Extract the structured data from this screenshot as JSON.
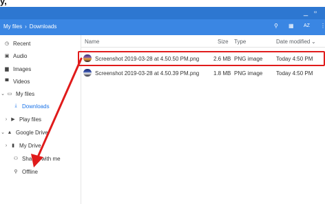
{
  "top_fragment": "y, ",
  "window": {
    "minimize": "_",
    "maximize": "▫"
  },
  "toolbar": {
    "breadcrumb": [
      "My files",
      "›",
      "Downloads"
    ],
    "icons": [
      "search-icon",
      "grid-view-icon",
      "sort-icon",
      "more-icon"
    ],
    "search_glyph": "⚲",
    "grid_glyph": "▦",
    "sort_glyph": "AZ",
    "more_glyph": "⋮"
  },
  "sidebar": {
    "items": [
      {
        "label": "Recent",
        "icon": "clock-icon",
        "glyph": "◷"
      },
      {
        "label": "Audio",
        "icon": "audio-icon",
        "glyph": "▣"
      },
      {
        "label": "Images",
        "icon": "image-icon",
        "glyph": "▆"
      },
      {
        "label": "Videos",
        "icon": "video-icon",
        "glyph": "▀"
      },
      {
        "label": "My files",
        "icon": "computer-icon",
        "glyph": "▭",
        "chevron": "⌄"
      },
      {
        "label": "Downloads",
        "icon": "download-icon",
        "glyph": "⤓",
        "active": true
      },
      {
        "label": "Play files",
        "icon": "play-icon",
        "glyph": "▶",
        "chevron": "›"
      },
      {
        "label": "Google Drive",
        "icon": "drive-icon",
        "glyph": "▲",
        "chevron": "⌄"
      },
      {
        "label": "My Drive",
        "icon": "folder-icon",
        "glyph": "▮",
        "chevron": "›"
      },
      {
        "label": "Shared with me",
        "icon": "people-icon",
        "glyph": "⚇"
      },
      {
        "label": "Offline",
        "icon": "pin-icon",
        "glyph": "⚲"
      }
    ]
  },
  "columns": {
    "name": "Name",
    "size": "Size",
    "type": "Type",
    "modified": "Date modified",
    "sort_indicator": "⌄"
  },
  "files": [
    {
      "name": "Screenshot 2019-03-28 at 4.50.50 PM.png",
      "size": "2.6 MB",
      "type": "PNG image",
      "modified": "Today 4:50 PM"
    },
    {
      "name": "Screenshot 2019-03-28 at 4.50.39 PM.png",
      "size": "1.8 MB",
      "type": "PNG image",
      "modified": "Today 4:50 PM"
    }
  ],
  "colors": {
    "titlebar": "#2d77d1",
    "toolbar": "#3a86e3",
    "active": "#1a73e8",
    "annotation": "#e01b1b"
  }
}
